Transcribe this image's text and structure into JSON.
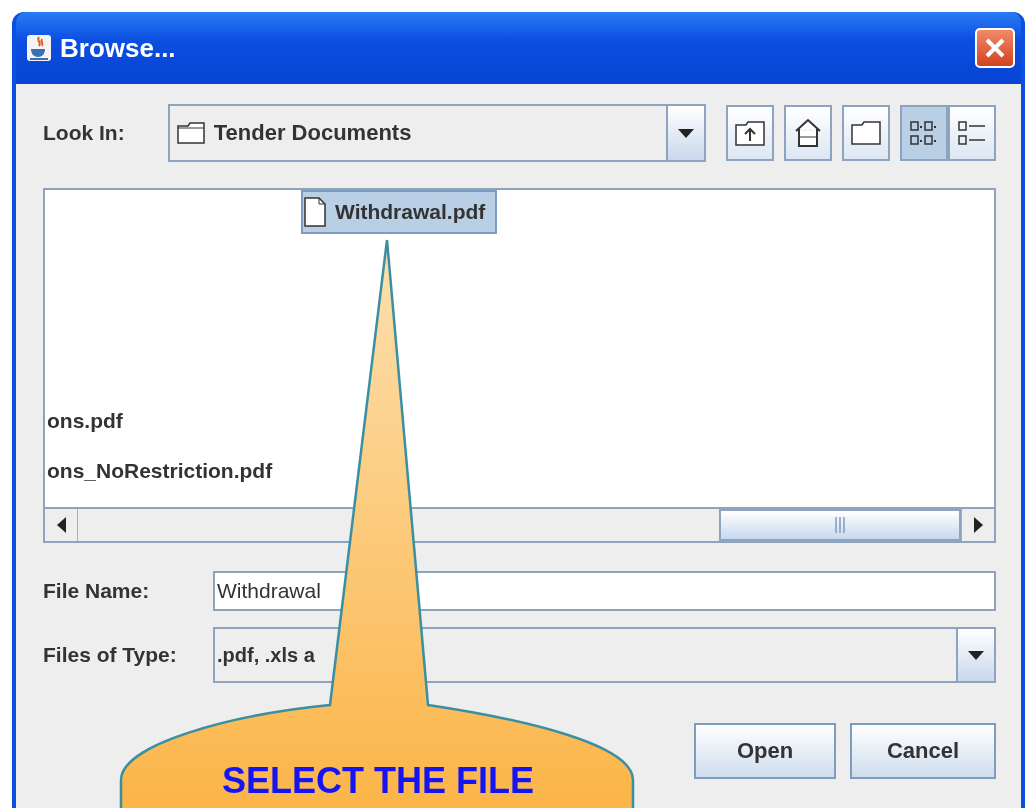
{
  "window": {
    "title": "Browse..."
  },
  "look_in": {
    "label": "Look In:",
    "value": "Tender Documents"
  },
  "nav_buttons": [
    {
      "kind": "up"
    },
    {
      "kind": "home"
    },
    {
      "kind": "new-folder"
    }
  ],
  "view_buttons": [
    {
      "kind": "list",
      "selected": true
    },
    {
      "kind": "details",
      "selected": false
    }
  ],
  "file_list": {
    "columns": [
      {
        "items": [
          {
            "name": "ons.pdf",
            "selected": false
          },
          {
            "name": "ons_NoRestriction.pdf",
            "selected": false
          }
        ]
      },
      {
        "items": [
          {
            "name": "Withdrawal.pdf",
            "selected": true
          }
        ]
      }
    ]
  },
  "file_name": {
    "label": "File Name:",
    "value": "Withdrawal"
  },
  "files_of_type": {
    "label": "Files of Type:",
    "value": ".pdf, .xls a"
  },
  "buttons": [
    {
      "label": "Open"
    },
    {
      "label": "Cancel"
    }
  ],
  "callout": {
    "text": "SELECT THE FILE"
  }
}
